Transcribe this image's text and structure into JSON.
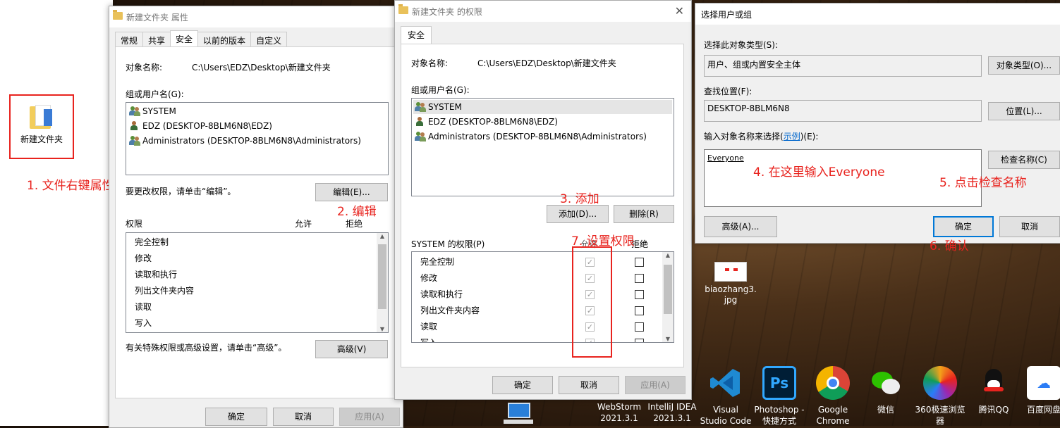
{
  "desktop": {
    "folder_label": "新建文件夹",
    "jpg_label": "biaozhang3.jpg",
    "taskbar": [
      {
        "label": "WebStorm 2021.3.1",
        "icon": "webstorm-icon",
        "color": "#111"
      },
      {
        "label": "IntelliJ IDEA 2021.3.1",
        "icon": "idea-icon",
        "color": "#111"
      },
      {
        "label": "Visual Studio Code",
        "icon": "vscode-icon",
        "color": "#0a74d3"
      },
      {
        "label": "Photoshop - 快捷方式",
        "icon": "photoshop-icon",
        "color": "#001e36"
      },
      {
        "label": "Google Chrome",
        "icon": "chrome-icon",
        "color": "#db4437"
      },
      {
        "label": "微信",
        "icon": "wechat-icon",
        "color": "#2dc100"
      },
      {
        "label": "360极速浏览器",
        "icon": "360-browser-icon",
        "color": "#f3a21a"
      },
      {
        "label": "腾讯QQ",
        "icon": "qq-icon",
        "color": "#222"
      },
      {
        "label": "百度网盘",
        "icon": "baidu-netdisk-icon",
        "color": "#2a7cf6"
      }
    ]
  },
  "props": {
    "title": "新建文件夹 属性",
    "tabs": [
      "常规",
      "共享",
      "安全",
      "以前的版本",
      "自定义"
    ],
    "object_label": "对象名称:",
    "object_value": "C:\\Users\\EDZ\\Desktop\\新建文件夹",
    "group_label": "组或用户名(G):",
    "users": [
      "SYSTEM",
      "EDZ (DESKTOP-8BLM6N8\\EDZ)",
      "Administrators (DESKTOP-8BLM6N8\\Administrators)"
    ],
    "change_hint": "要更改权限，请单击“编辑”。",
    "edit_btn": "编辑(E)...",
    "perm_label": "权限",
    "allow": "允许",
    "deny": "拒绝",
    "perms": [
      "完全控制",
      "修改",
      "读取和执行",
      "列出文件夹内容",
      "读取",
      "写入"
    ],
    "adv_hint": "有关特殊权限或高级设置，请单击“高级”。",
    "adv_btn": "高级(V)",
    "ok": "确定",
    "cancel": "取消",
    "apply": "应用(A)"
  },
  "perm_dialog": {
    "title": "新建文件夹 的权限",
    "tab": "安全",
    "object_label": "对象名称:",
    "object_value": "C:\\Users\\EDZ\\Desktop\\新建文件夹",
    "group_label": "组或用户名(G):",
    "users": [
      "SYSTEM",
      "EDZ (DESKTOP-8BLM6N8\\EDZ)",
      "Administrators (DESKTOP-8BLM6N8\\Administrators)"
    ],
    "add_btn": "添加(D)...",
    "remove_btn": "删除(R)",
    "perm_label": "SYSTEM 的权限(P)",
    "allow": "允许",
    "deny": "拒绝",
    "perms": [
      "完全控制",
      "修改",
      "读取和执行",
      "列出文件夹内容",
      "读取",
      "写入"
    ],
    "ok": "确定",
    "cancel": "取消",
    "apply": "应用(A)"
  },
  "select_dialog": {
    "title": "选择用户或组",
    "type_label": "选择此对象类型(S):",
    "type_value": "用户、组或内置安全主体",
    "type_btn": "对象类型(O)...",
    "loc_label": "查找位置(F):",
    "loc_value": "DESKTOP-8BLM6N8",
    "loc_btn": "位置(L)...",
    "enter_label": "输入对象名称来选择",
    "enter_link": "示例",
    "enter_suffix": "(E):",
    "enter_value": "Everyone",
    "check_btn": "检查名称(C)",
    "adv_btn": "高级(A)...",
    "ok": "确定",
    "cancel": "取消"
  },
  "annotations": {
    "a1": "1. 文件右键属性",
    "a2": "2. 编辑",
    "a3": "3. 添加",
    "a4": "4. 在这里输入Everyone",
    "a5": "5. 点击检查名称",
    "a6": "6. 确认",
    "a7": "7. 设置权限"
  },
  "colors": {
    "annotation": "#e8231e",
    "accent": "#0078d7"
  }
}
